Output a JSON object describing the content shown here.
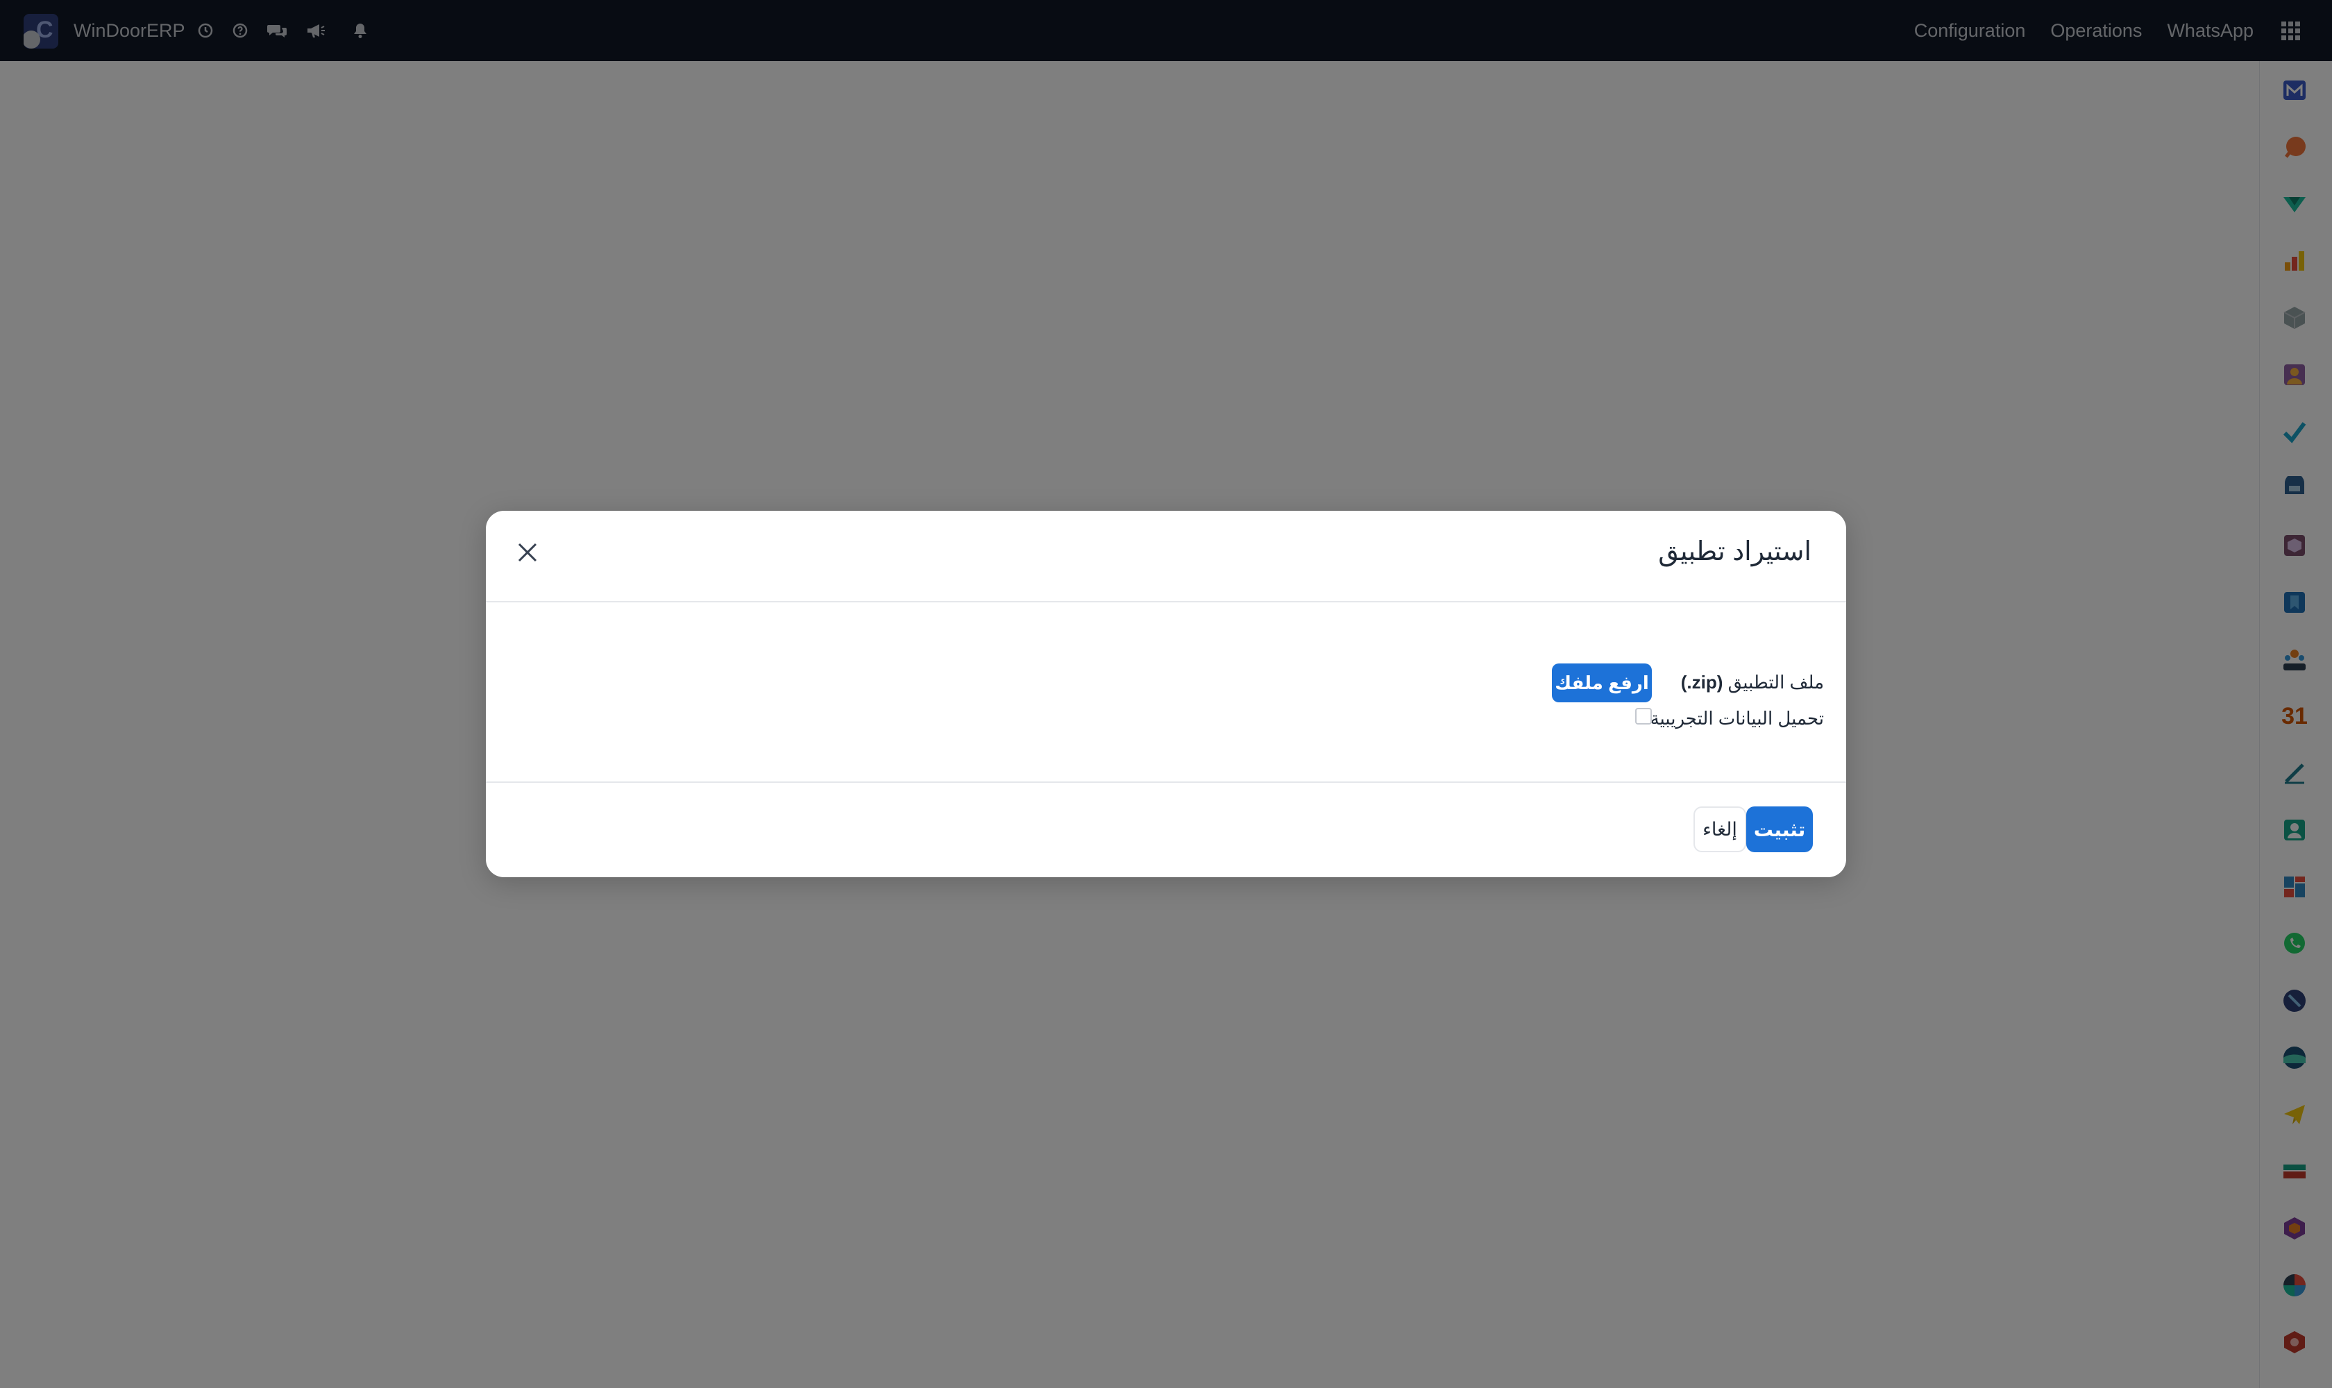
{
  "navbar": {
    "brand": "WinDoorERP",
    "logo_letter": "C",
    "menu": [
      "Configuration",
      "Operations",
      "WhatsApp"
    ],
    "icons": [
      "clock-icon",
      "help-icon",
      "chat-icon",
      "megaphone-icon",
      "bell-icon"
    ]
  },
  "dock": {
    "items": [
      "gmail-icon",
      "chat-bubble-icon",
      "chevron-app-icon",
      "reporting-icon",
      "cube-icon",
      "employees-icon",
      "check-icon",
      "helpdesk-icon",
      "inventory-icon",
      "documents-icon",
      "team-icon",
      "calendar-icon",
      "sign-icon",
      "contacts-icon",
      "dashboard-icon",
      "whatsapp-icon",
      "discuss-icon",
      "website-icon",
      "telegram-icon",
      "bank-icon",
      "module-icon",
      "pie-icon",
      "settings-hex-icon"
    ],
    "calendar_label": "31"
  },
  "modal": {
    "title": "استيراد تطبيق",
    "file_label": "ملف التطبيق",
    "file_ext": "(.zip)",
    "upload_button": "ارفع ملفك",
    "demo_data_label": "تحميل البيانات التجريبية",
    "install_button": "تثبيت",
    "cancel_button": "إلغاء"
  },
  "colors": {
    "navbar_bg": "#111827",
    "primary": "#1d72d8",
    "overlay": "rgba(0,0,0,0.5)"
  }
}
